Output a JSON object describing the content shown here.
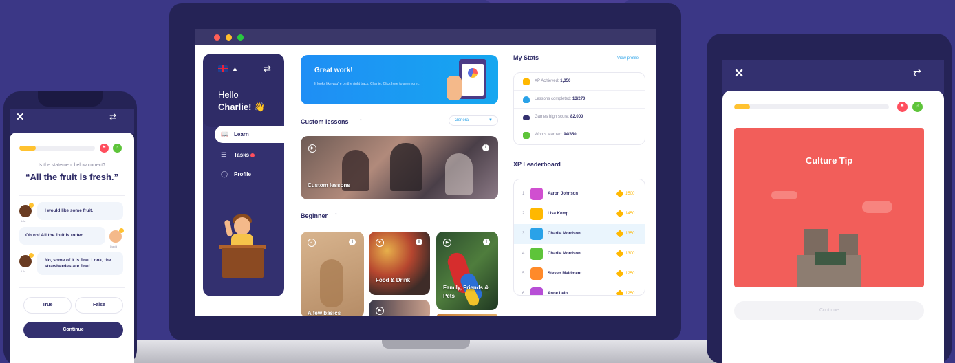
{
  "laptop": {
    "sidebar": {
      "hello": "Hello",
      "name": "Charlie! 👋",
      "nav": [
        {
          "label": "Learn",
          "icon": "book-icon"
        },
        {
          "label": "Tasks",
          "icon": "tasks-icon"
        },
        {
          "label": "Profile",
          "icon": "profile-icon"
        }
      ]
    },
    "banner": {
      "title": "Great work!",
      "subtitle": "It looks like you're on the right track, Charlie. Click here to see more..."
    },
    "custom_lessons": {
      "title": "Custom lessons",
      "dropdown_value": "General",
      "card_label": "Custom lessons"
    },
    "beginner": {
      "title": "Beginner",
      "cards": [
        {
          "label": "A few basics"
        },
        {
          "label": "Food & Drink"
        },
        {
          "label": "Family, Friends & Pets"
        }
      ]
    },
    "stats": {
      "title": "My Stats",
      "view_profile": "View profile",
      "rows": [
        {
          "label": "XP Achieved:",
          "value": "1,350",
          "color": "#ffb800"
        },
        {
          "label": "Lessons completed:",
          "value": "13/270",
          "color": "#2aa2e8"
        },
        {
          "label": "Games high score:",
          "value": "82,000",
          "color": "#33306f"
        },
        {
          "label": "Words learned:",
          "value": "94/850",
          "color": "#5ec43a"
        }
      ]
    },
    "leaderboard": {
      "title": "XP Leaderboard",
      "rows": [
        {
          "rank": "1",
          "name": "Aaron Johnson",
          "score": "1500",
          "avatar": "#d04fd0"
        },
        {
          "rank": "2",
          "name": "Lisa Kemp",
          "score": "1450",
          "avatar": "#ffb800"
        },
        {
          "rank": "3",
          "name": "Charlie Morrison",
          "score": "1350",
          "avatar": "#2aa2e8"
        },
        {
          "rank": "4",
          "name": "Charlie Morrison",
          "score": "1300",
          "avatar": "#5ec43a"
        },
        {
          "rank": "5",
          "name": "Steven Maidment",
          "score": "1250",
          "avatar": "#ff8a2a"
        },
        {
          "rank": "6",
          "name": "Anne Lein",
          "score": "1250",
          "avatar": "#b74fd6"
        }
      ]
    }
  },
  "phone": {
    "question_prompt": "Is the statement below correct?",
    "statement": "“All the fruit is fresh.”",
    "messages": [
      {
        "text": "I would like some fruit.",
        "speaker": "Lila"
      },
      {
        "text": "Oh no! All the fruit is rotten.",
        "speaker": "David"
      },
      {
        "text": "No, some of it is fine! Look, the strawberries are fine!",
        "speaker": "Lila"
      }
    ],
    "options": [
      "True",
      "False"
    ],
    "continue_label": "Continue",
    "progress": 0.18
  },
  "tablet": {
    "card_title": "Culture Tip",
    "continue_label": "Continue",
    "progress": 0.1
  }
}
